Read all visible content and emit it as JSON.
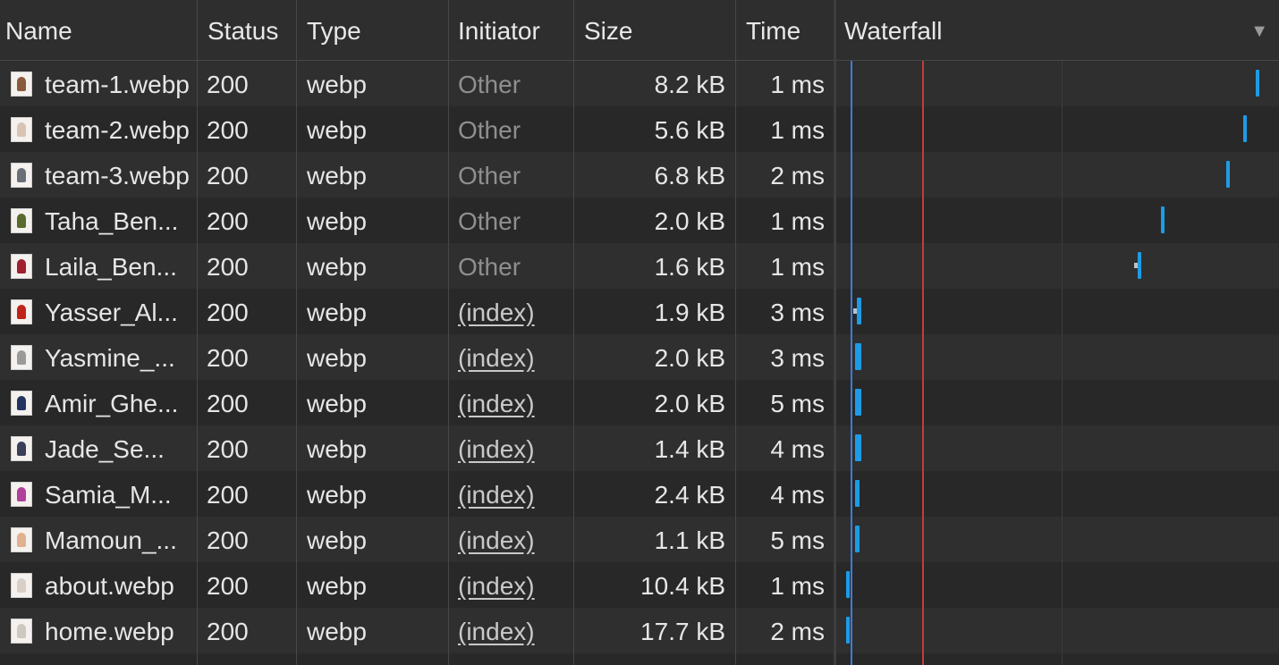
{
  "columns": {
    "name": "Name",
    "status": "Status",
    "type": "Type",
    "initiator": "Initiator",
    "size": "Size",
    "time": "Time",
    "waterfall": "Waterfall"
  },
  "colors": {
    "waterfall_bar": "#1e9be6",
    "dom_content_loaded_line": "#3b7dd8",
    "load_line": "#c43b3b",
    "initiator_other": "#8f8f8f"
  },
  "rows": [
    {
      "name": "team-1.webp",
      "status": "200",
      "type": "webp",
      "initiator": "Other",
      "size": "8.2 kB",
      "time": "1 ms",
      "thumb_color": "#8a5a3c"
    },
    {
      "name": "team-2.webp",
      "status": "200",
      "type": "webp",
      "initiator": "Other",
      "size": "5.6 kB",
      "time": "1 ms",
      "thumb_color": "#d8c4b4"
    },
    {
      "name": "team-3.webp",
      "status": "200",
      "type": "webp",
      "initiator": "Other",
      "size": "6.8 kB",
      "time": "2 ms",
      "thumb_color": "#6b6f78"
    },
    {
      "name": "Taha_Ben...",
      "status": "200",
      "type": "webp",
      "initiator": "Other",
      "size": "2.0 kB",
      "time": "1 ms",
      "thumb_color": "#5b6a2e"
    },
    {
      "name": "Laila_Ben...",
      "status": "200",
      "type": "webp",
      "initiator": "Other",
      "size": "1.6 kB",
      "time": "1 ms",
      "thumb_color": "#a02030"
    },
    {
      "name": "Yasser_Al...",
      "status": "200",
      "type": "webp",
      "initiator": "(index)",
      "size": "1.9 kB",
      "time": "3 ms",
      "thumb_color": "#c02418"
    },
    {
      "name": "Yasmine_...",
      "status": "200",
      "type": "webp",
      "initiator": "(index)",
      "size": "2.0 kB",
      "time": "3 ms",
      "thumb_color": "#9a9a9a"
    },
    {
      "name": "Amir_Ghe...",
      "status": "200",
      "type": "webp",
      "initiator": "(index)",
      "size": "2.0 kB",
      "time": "5 ms",
      "thumb_color": "#23355e"
    },
    {
      "name": "Jade_Se...",
      "status": "200",
      "type": "webp",
      "initiator": "(index)",
      "size": "1.4 kB",
      "time": "4 ms",
      "thumb_color": "#3a3f5a"
    },
    {
      "name": "Samia_M...",
      "status": "200",
      "type": "webp",
      "initiator": "(index)",
      "size": "2.4 kB",
      "time": "4 ms",
      "thumb_color": "#b0409a"
    },
    {
      "name": "Mamoun_...",
      "status": "200",
      "type": "webp",
      "initiator": "(index)",
      "size": "1.1 kB",
      "time": "5 ms",
      "thumb_color": "#e0b090"
    },
    {
      "name": "about.webp",
      "status": "200",
      "type": "webp",
      "initiator": "(index)",
      "size": "10.4 kB",
      "time": "1 ms",
      "thumb_color": "#d8d0c8"
    },
    {
      "name": "home.webp",
      "status": "200",
      "type": "webp",
      "initiator": "(index)",
      "size": "17.7 kB",
      "time": "2 ms",
      "thumb_color": "#cfc8c0"
    }
  ]
}
